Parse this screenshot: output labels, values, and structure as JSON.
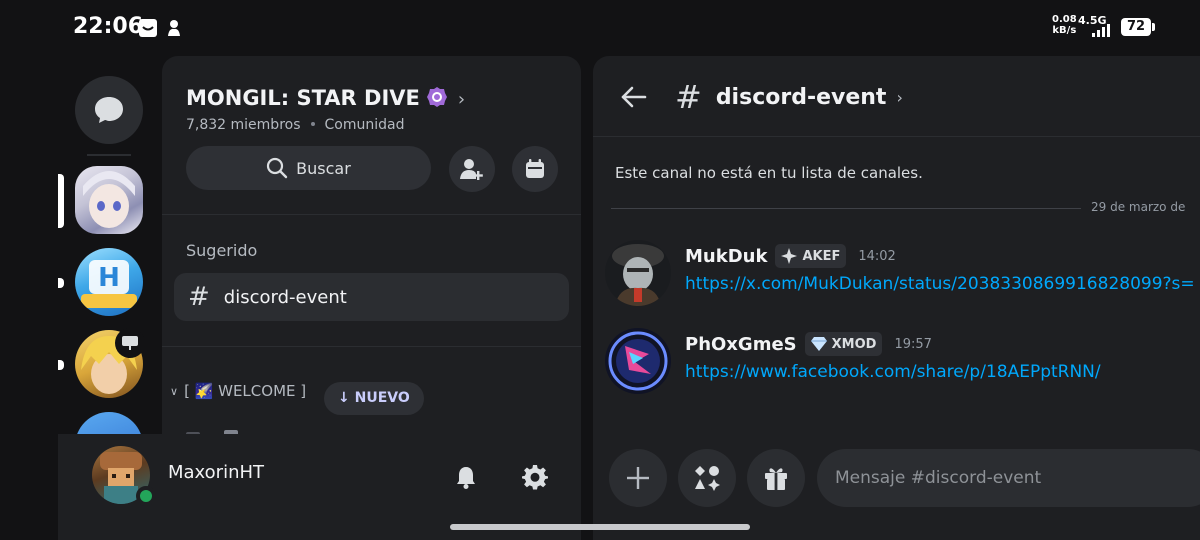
{
  "status_bar": {
    "time": "22:06",
    "net_speed": "0.08",
    "net_unit": "kB/s",
    "network_type": "4.5G",
    "battery": "72",
    "icons": [
      "notification-box-icon",
      "app-notification-icon",
      "signal-icon",
      "battery-icon"
    ]
  },
  "server_rail": {
    "dm_icon": "chat-bubble-icon",
    "servers": [
      "server-anime-girl",
      "server-h-logo",
      "server-blonde-character",
      "server-blue-partial"
    ]
  },
  "guild": {
    "name": "MONGIL: STAR DIVE",
    "members": "7,832 miembros",
    "type": "Comunidad",
    "search_label": "Buscar",
    "suggested_label": "Sugerido",
    "suggested_channel": "discord-event",
    "category_name": "[ 🌠 WELCOME ]",
    "new_label": "↓ NUEVO"
  },
  "user": {
    "name": "MaxorinHT",
    "status": "online"
  },
  "chat": {
    "channel": "discord-event",
    "notice": "Este canal no está en tu lista de canales.",
    "date": "29 de marzo de",
    "messages": [
      {
        "user": "MukDuk",
        "tag": "AKEF",
        "time": "14:02",
        "text": "https://x.com/MukDukan/status/2038330869916828099?s="
      },
      {
        "user": "PhOxGmeS",
        "tag": "XMOD",
        "time": "19:57",
        "text": "https://www.facebook.com/share/p/18AEPptRNN/"
      }
    ],
    "input_placeholder": "Mensaje #discord-event"
  },
  "colors": {
    "link": "#00a8fc",
    "online": "#23a55a",
    "panel_bg": "#1e1f22",
    "new_pill_text": "#c9cdfb"
  }
}
